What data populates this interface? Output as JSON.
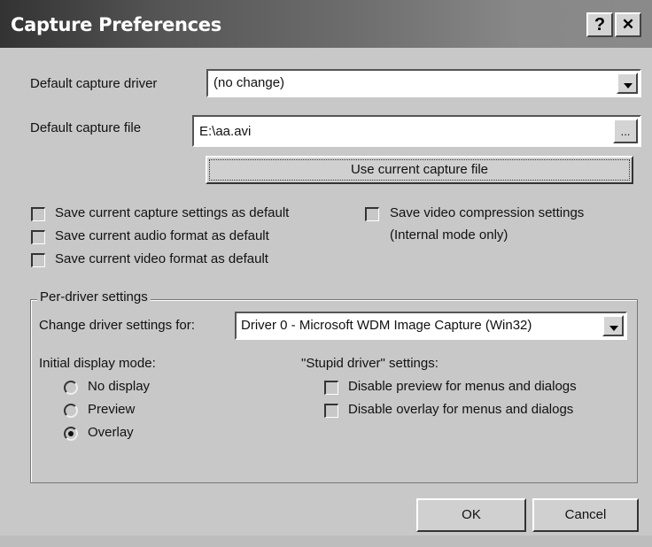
{
  "window": {
    "title": "Capture Preferences",
    "help_button": "?",
    "close_button": "✕"
  },
  "capture_driver": {
    "label": "Default capture driver",
    "value": "(no change)"
  },
  "capture_file": {
    "label": "Default capture file",
    "value": "E:\\aa.avi",
    "browse_label": "...",
    "use_current_label": "Use current capture file"
  },
  "checkboxes": {
    "save_capture_settings": "Save current capture settings as default",
    "save_audio_format": "Save current audio format as default",
    "save_video_format": "Save current video format as default",
    "save_video_compression_line1": "Save video compression settings",
    "save_video_compression_line2": "(Internal mode only)"
  },
  "per_driver": {
    "legend": "Per-driver settings",
    "change_label": "Change driver settings for:",
    "driver_value": "Driver 0 - Microsoft WDM Image Capture (Win32)",
    "display_mode_label": "Initial display mode:",
    "display_modes": [
      "No display",
      "Preview",
      "Overlay"
    ],
    "selected_mode": "Overlay",
    "stupid_label": "\"Stupid driver\" settings:",
    "disable_preview": "Disable preview for menus and dialogs",
    "disable_overlay": "Disable overlay for menus and dialogs"
  },
  "buttons": {
    "ok": "OK",
    "cancel": "Cancel"
  }
}
